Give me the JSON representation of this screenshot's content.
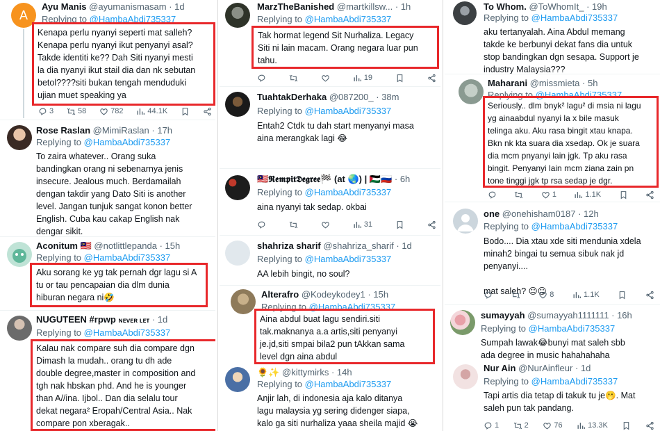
{
  "col1": {
    "t1": {
      "name": "Ayu Manis",
      "handle": "@ayumanismasam",
      "time": "· 1d",
      "replying": "Replying to",
      "to": "@HambaAbdi735337",
      "avatar_letter": "A",
      "body": "Kenapa perlu nyanyi seperti mat salleh?\nKenapa perlu nyanyi ikut penyanyi asal?\nTakde identiti ke?? Dah Siti nyanyi mesti\nla dia nyanyi ikut stail dia dan nk sebutan\nbetol????siti bukan tengah menduduki\nujian muet speaking ya",
      "replies": "3",
      "retweets": "58",
      "likes": "782",
      "views": "44.1K"
    },
    "t2": {
      "name": "Rose Raslan",
      "handle": "@MimiRaslan",
      "time": "· 17h",
      "replying": "Replying to",
      "to": "@HambaAbdi735337",
      "body": "To zaira whatever.. Orang suka\nbandingkan orang ni sebenarnya jenis\ninsecure. Jealous much. Berdamailah\ndengan takdir yang Dato Siti is another\nlevel. Jangan tunjuk sangat konon better\nEnglish. Cuba kau cakap English nak\ndengar sikit."
    },
    "t3": {
      "name": "Aconitum",
      "flag": "🇲🇾",
      "handle": "@notlittlepanda",
      "time": "· 15h",
      "replying": "Replying to",
      "to": "@HambaAbdi735337",
      "body": "Aku sorang ke yg tak pernah dgr lagu si A\ntu or tau pencapaian dia dlm dunia\nhiburan negara ni🤣"
    },
    "t4": {
      "name": "NUGUTEEN #rpwp",
      "name_suffix": "ɴᴇᴠᴇʀ ʟᴇᴛ",
      "time": "· 1d",
      "replying": "Replying to",
      "to": "@HambaAbdi735337",
      "body": "Kalau nak compare suh dia compare dgn\nDimash la mudah.. orang tu dh ade\ndouble degree,master in composition and\ntgh nak hbskan phd. And he is younger\nthan A//ina. Ijbol.. Dan dia selalu tour\ndekat negara² Eropah/Central Asia.. Nak\ncompare pon xberagak.."
    }
  },
  "col2": {
    "t1": {
      "name": "MarzTheBanished",
      "handle": "@martkillsw...",
      "time": "· 1h",
      "replying": "Replying to",
      "to": "@HambaAbdi735337",
      "body": "Tak hormat legend Sit Nurhaliza. Legacy\nSiti ni lain macam. Orang negara luar pun\ntahu.",
      "views": "19"
    },
    "t2": {
      "name": "TuahtakDerhaka",
      "handle": "@087200_",
      "time": "· 38m",
      "replying": "Replying to",
      "to": "@HambaAbdi735337",
      "body": "Entah2 Ctdk tu dah start menyanyi masa\naina merangkak lagi 😂"
    },
    "t3": {
      "name": "🇲🇾𝕽𝖊𝖒𝖕𝖎𝖙𝕯𝖊𝖌𝖗𝖊𝖊🏁 (at 🌏) | 🇵🇸🇷🇺",
      "time": "· 6h",
      "replying": "Replying to",
      "to": "@HambaAbdi735337",
      "body": "aina nyanyi tak sedap. okbai",
      "views": "31"
    },
    "t4": {
      "name": "shahriza sharif",
      "handle": "@shahriza_sharif",
      "time": "· 1d",
      "replying": "Replying to",
      "to": "@HambaAbdi735337",
      "body": "AA lebih bingit, no soul?"
    },
    "t5": {
      "name": "Alterafro",
      "handle": "@Kodeykodey1",
      "time": "· 15h",
      "replying": "Replying to",
      "to": "@HambaAbdi735337",
      "body": "Aina abdul buat lagu sendiri.siti\ntak.maknanya a.a artis,siti penyanyi\nje.jd,siti smpai bila2 pun tAkkan sama\nlevel dgn aina abdul"
    },
    "t6": {
      "name": "🌻✨",
      "handle": "@kittymirks",
      "time": "· 14h",
      "replying": "Replying to",
      "to": "@HambaAbdi735337",
      "body": "Anjir lah, di indonesia aja kalo ditanya\nlagu malaysia yg sering didenger siapa,\nkalo ga siti nurhaliza yaaa sheila majid 😭"
    }
  },
  "col3": {
    "t1": {
      "name": "To Whom.",
      "handle": "@ToWhomIt_",
      "time": "· 19h",
      "replying": "Replying to",
      "to": "@HambaAbdi735337",
      "body": "aku tertanyalah. Aina Abdul memang\ntakde ke berbunyi dekat fans dia untuk\nstop bandingkan dgn sesapa. Support je\nindustry Malaysia???"
    },
    "t2": {
      "name": "Maharani",
      "handle": "@missmieta",
      "time": "· 5h",
      "replying": "Replying to",
      "to": "@HambaAbdi735337",
      "body": "Seriously.. dlm bnyk² lagu² di msia ni lagu\nyg ainaabdul nyanyi la x bile masuk\ntelinga aku. Aku rasa bingit xtau knapa.\nBkn nk kta suara dia xsedap. Ok je suara\ndia mcm pnyanyi lain jgk. Tp aku rasa\nbingit. Penyanyi lain mcm ziana zain pn\ntone tinggi jgk tp rsa sedap je dgr.",
      "likes": "1",
      "views": "1.1K"
    },
    "t3": {
      "name": "one",
      "handle": "@onehisham0187",
      "time": "· 12h",
      "replying": "Replying to",
      "to": "@HambaAbdi735337",
      "body": "Bodo.... Dia xtau xde siti mendunia xdela\nminah2 bingai tu semua sibuk nak jd\npenyanyi....\n\nmat saleh? 😐😐",
      "likes": "8",
      "views": "1.1K"
    },
    "t4": {
      "name": "sumayyah",
      "handle": "@sumayyah1111111",
      "time": "· 16h",
      "replying": "Replying to",
      "to": "@HambaAbdi735337",
      "body": "Sumpah lawak😂bunyi mat saleh sbb\nada degree in music hahahahaha"
    },
    "t5": {
      "name": "Nur Ain",
      "handle": "@NurAinfleur",
      "time": "· 1d",
      "replying": "Replying to",
      "to": "@HambaAbdi735337",
      "body": "Tapi artis dia tetap di takuk tu je🫢. Mat\nsaleh pun tak pandang.",
      "replies": "1",
      "retweets": "2",
      "likes": "76",
      "views": "13.3K"
    }
  },
  "colors": {
    "highlight": "#e8282b",
    "link": "#1d9bf0",
    "muted": "#536471",
    "avatar_orange": "#f7931e"
  }
}
